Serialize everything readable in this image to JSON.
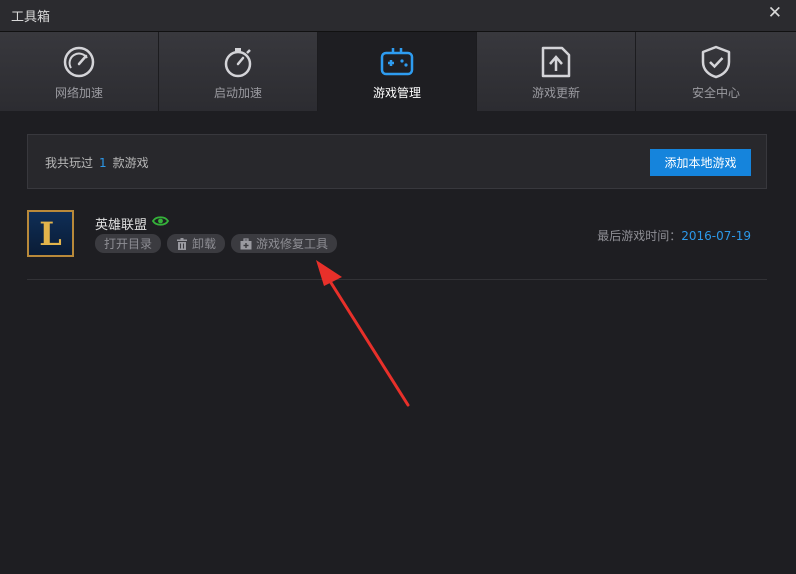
{
  "window": {
    "title": "工具箱",
    "close_glyph": "✕"
  },
  "tabs": [
    {
      "label": "网络加速",
      "icon": "speedometer-icon",
      "active": false
    },
    {
      "label": "启动加速",
      "icon": "stopwatch-icon",
      "active": false
    },
    {
      "label": "游戏管理",
      "icon": "gamepad-icon",
      "active": true
    },
    {
      "label": "游戏更新",
      "icon": "update-box-icon",
      "active": false
    },
    {
      "label": "安全中心",
      "icon": "shield-check-icon",
      "active": false
    }
  ],
  "summary": {
    "prefix": "我共玩过",
    "count": "1",
    "suffix": "款游戏",
    "add_button": "添加本地游戏"
  },
  "games": [
    {
      "name": "英雄联盟",
      "logo_letter": "L",
      "visible_icon": "eye-icon",
      "actions": {
        "open_dir": "打开目录",
        "uninstall": "卸载",
        "repair": "游戏修复工具"
      },
      "last_played_label": "最后游戏时间：",
      "last_played_date": "2016-07-19"
    }
  ],
  "colors": {
    "accent": "#1584dc",
    "link": "#2c98e8",
    "annotation_arrow": "#e8302a",
    "eye": "#35b23a"
  }
}
